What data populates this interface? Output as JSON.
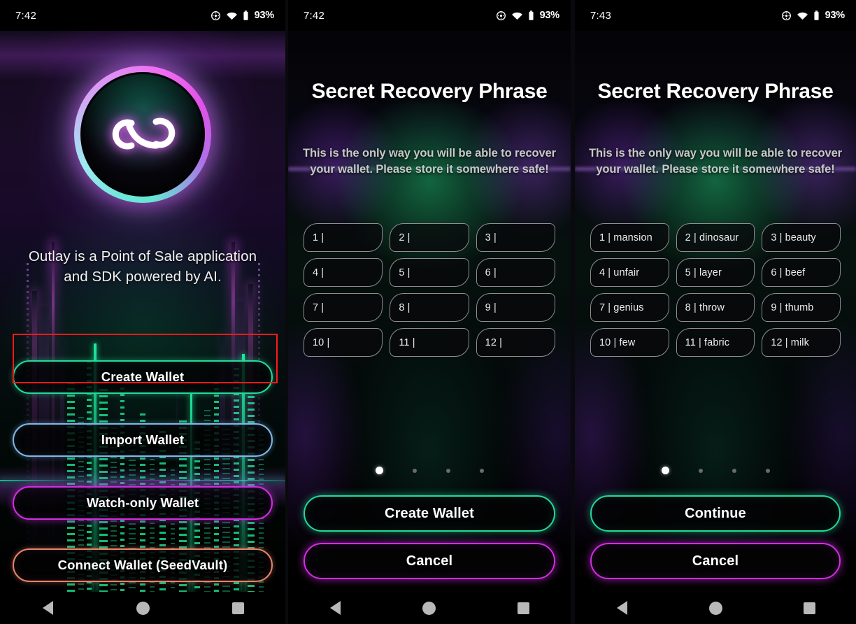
{
  "panels": [
    {
      "status": {
        "time": "7:42",
        "battery": "93%",
        "icons": [
          "alarm-icon",
          "wifi-icon",
          "battery-icon"
        ]
      },
      "logo": {
        "name": "outlay-logo"
      },
      "tagline": "Outlay is a Point of Sale application and SDK powered by AI.",
      "buttons": [
        {
          "label": "Create Wallet",
          "color": "#25d99a",
          "highlighted": true
        },
        {
          "label": "Import Wallet",
          "color": "#7fb8e8",
          "highlighted": false
        },
        {
          "label": "Watch-only Wallet",
          "color": "#cf2fe0",
          "highlighted": false
        },
        {
          "label": "Connect Wallet (SeedVault)",
          "color": "#e8836e",
          "highlighted": false
        }
      ],
      "annotation": {
        "color": "#ff1a1a",
        "target": "Create Wallet"
      }
    },
    {
      "status": {
        "time": "7:42",
        "battery": "93%"
      },
      "title": "Secret Recovery Phrase",
      "subtitle": "This is the only way you will be able to recover your wallet. Please store it somewhere safe!",
      "words": [
        "1 |",
        "2 |",
        "3 |",
        "4 |",
        "5 |",
        "6 |",
        "7 |",
        "8 |",
        "9 |",
        "10 |",
        "11 |",
        "12 |"
      ],
      "pager": {
        "count": 4,
        "active": 0
      },
      "actions": [
        {
          "label": "Create Wallet",
          "color": "#25d99a"
        },
        {
          "label": "Cancel",
          "color": "#d42ce6"
        }
      ]
    },
    {
      "status": {
        "time": "7:43",
        "battery": "93%"
      },
      "title": "Secret Recovery Phrase",
      "subtitle": "This is the only way you will be able to recover your wallet. Please store it somewhere safe!",
      "words": [
        "1 | mansion",
        "2 | dinosaur",
        "3 | beauty",
        "4 | unfair",
        "5 | layer",
        "6 | beef",
        "7 | genius",
        "8 | throw",
        "9 | thumb",
        "10 | few",
        "11 | fabric",
        "12 | milk"
      ],
      "pager": {
        "count": 4,
        "active": 0
      },
      "actions": [
        {
          "label": "Continue",
          "color": "#25d99a"
        },
        {
          "label": "Cancel",
          "color": "#d42ce6"
        }
      ]
    }
  ],
  "navbar": {
    "back": "back-icon",
    "home": "home-icon",
    "recents": "recents-icon"
  }
}
